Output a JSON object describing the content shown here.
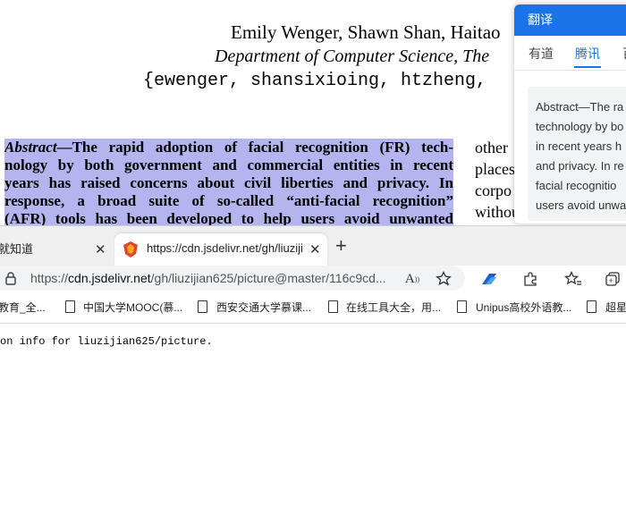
{
  "paper": {
    "authors": "Emily Wenger, Shawn Shan, Haitao",
    "department": "Department of Computer Science, The",
    "emails": "{ewenger, shansixioing, htzheng,",
    "abstract_lines": [
      [
        "Abstract",
        "—The rapid adoption of facial recognition (FR) tech-"
      ],
      [
        "",
        "nology by both government and commercial entities in recent"
      ],
      [
        "",
        "years has raised concerns about civil liberties and privacy. In"
      ],
      [
        "",
        "response, a broad suite of so-called “anti-facial recognition”"
      ],
      [
        "",
        "(AFR) tools has been developed to help users avoid unwanted"
      ]
    ],
    "right_column": [
      "other",
      "places",
      "corpo",
      "withou"
    ]
  },
  "translate_panel": {
    "title": "翻译",
    "tabs": [
      "有道",
      "腾讯",
      "百"
    ],
    "active_tab": "腾讯",
    "text_lines": [
      "Abstract—The ra",
      "technology by bo",
      "in recent years h",
      "and privacy. In re",
      "facial recognitio",
      "users avoid unwa"
    ]
  },
  "browser": {
    "tabs": [
      {
        "title": "就知道",
        "active": false
      },
      {
        "title": "https://cdn.jsdelivr.net/gh/liuzijian",
        "active": true
      }
    ],
    "url_prefix": "https://",
    "url_host": "cdn.jsdelivr.net",
    "url_path": "/gh/liuzijian625/picture@master/116c9cd...",
    "bookmarks": [
      "教育_全...",
      "中国大学MOOC(慕...",
      "西安交通大学慕课...",
      "在线工具大全，用...",
      "Unipus高校外语教...",
      "超星"
    ],
    "page_text": "on info for liuzijian625/picture.",
    "colors": {
      "accent": "#1a73e8",
      "highlight": "#b4b4ee",
      "edge_blue": "#1e62c7",
      "favicon": "#e0452b"
    }
  }
}
